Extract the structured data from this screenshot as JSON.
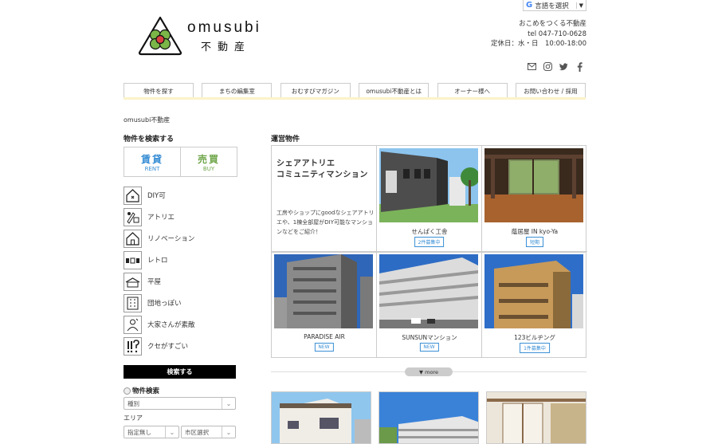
{
  "header": {
    "brand_name": "omusubi",
    "brand_sub": "不動産",
    "translate_label": "言語を選択",
    "tagline": "おこめをつくる不動産",
    "tel": "tel 047-710-0628",
    "hours": "定休日：水・日　10:00-18:00",
    "social_icons": [
      "mail-icon",
      "instagram-icon",
      "twitter-icon",
      "facebook-icon"
    ]
  },
  "nav": {
    "items": [
      "物件を探す",
      "まちの編集室",
      "おむすびマガジン",
      "omusubi不動産とは",
      "オーナー様へ",
      "お問い合わせ / 採用"
    ]
  },
  "breadcrumb": "omusubi不動産",
  "sidebar": {
    "title": "物件を検索する",
    "rent_big": "賃貸",
    "rent_small": "RENT",
    "buy_big": "売買",
    "buy_small": "BUY",
    "categories": [
      {
        "label": "DIY可",
        "icon": "diy-icon"
      },
      {
        "label": "アトリエ",
        "icon": "atelier-icon"
      },
      {
        "label": "リノベーション",
        "icon": "renovation-icon"
      },
      {
        "label": "レトロ",
        "icon": "retro-icon"
      },
      {
        "label": "平屋",
        "icon": "one-story-house-icon"
      },
      {
        "label": "団地っぽい",
        "icon": "apartment-complex-icon"
      },
      {
        "label": "大家さんが素敵",
        "icon": "landlord-icon"
      },
      {
        "label": "クセがすごい",
        "icon": "quirky-icon"
      }
    ],
    "search_button": "検索する",
    "filter_title": "物件検索",
    "type_select": "種別",
    "area_label": "エリア",
    "area_select_1": "指定無し",
    "area_select_2": "市区選択"
  },
  "main": {
    "title": "運営物件",
    "feature_title_1": "シェアアトリエ",
    "feature_title_2": "コミュニティマンション",
    "feature_desc": "工房やショップにgoodなシェアアトリエや、1棟全部屋がDIY可能なマンションなどをご紹介！",
    "properties": [
      {
        "name": "せんぱく工舎",
        "badge": "2件募集中"
      },
      {
        "name": "蔭居屋 IN kyo-Ya",
        "badge": "短期"
      },
      {
        "name": "PARADISE AIR",
        "badge": "NEW"
      },
      {
        "name": "SUNSUNマンション",
        "badge": "NEW"
      },
      {
        "name": "123ビルヂング",
        "badge": "1件募集中"
      }
    ],
    "more_label": "▼ more"
  },
  "colors": {
    "accent_blue": "#3a8fd5",
    "accent_green": "#6fa64a",
    "nav_underline": "#fbf3c9"
  }
}
